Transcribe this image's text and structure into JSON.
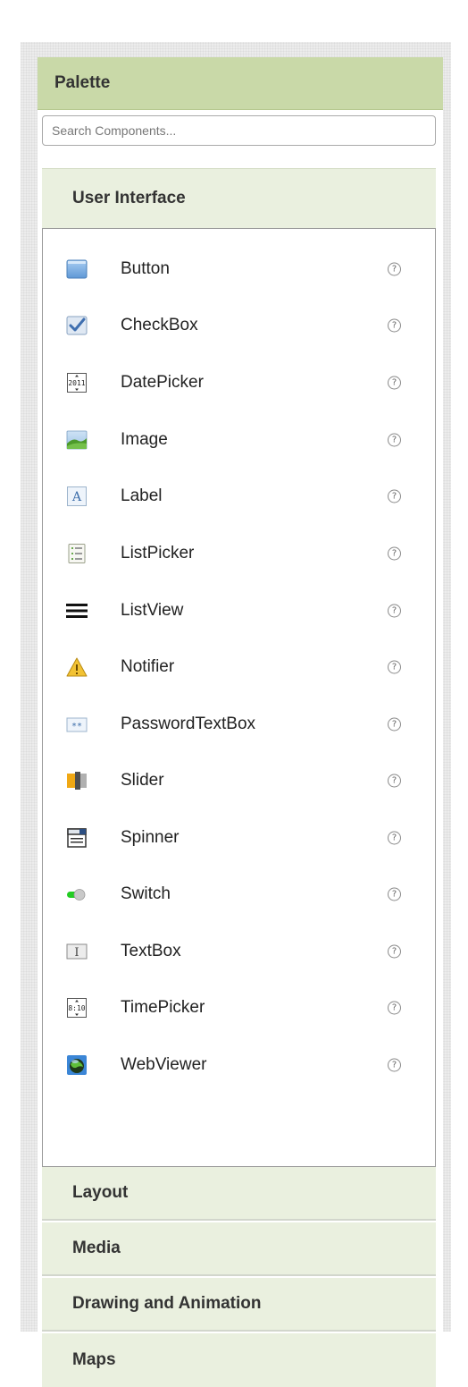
{
  "palette": {
    "title": "Palette",
    "search_placeholder": "Search Components..."
  },
  "user_interface": {
    "title": "User Interface",
    "items": [
      {
        "label": "Button",
        "icon": "button-icon"
      },
      {
        "label": "CheckBox",
        "icon": "checkbox-icon"
      },
      {
        "label": "DatePicker",
        "icon": "datepicker-icon"
      },
      {
        "label": "Image",
        "icon": "image-icon"
      },
      {
        "label": "Label",
        "icon": "label-icon"
      },
      {
        "label": "ListPicker",
        "icon": "listpicker-icon"
      },
      {
        "label": "ListView",
        "icon": "listview-icon"
      },
      {
        "label": "Notifier",
        "icon": "notifier-icon"
      },
      {
        "label": "PasswordTextBox",
        "icon": "passwordtextbox-icon"
      },
      {
        "label": "Slider",
        "icon": "slider-icon"
      },
      {
        "label": "Spinner",
        "icon": "spinner-icon"
      },
      {
        "label": "Switch",
        "icon": "switch-icon"
      },
      {
        "label": "TextBox",
        "icon": "textbox-icon"
      },
      {
        "label": "TimePicker",
        "icon": "timepicker-icon"
      },
      {
        "label": "WebViewer",
        "icon": "webviewer-icon"
      }
    ],
    "help_glyph": "?",
    "datepicker_icon_text": "2011",
    "timepicker_icon_text": "8:10",
    "label_icon_text": "A",
    "textbox_icon_text": "I",
    "password_icon_text": "**"
  },
  "categories": [
    {
      "label": "Layout"
    },
    {
      "label": "Media"
    },
    {
      "label": "Drawing and Animation"
    },
    {
      "label": "Maps"
    }
  ],
  "colors": {
    "header_bg": "#c9d9a8",
    "drawer_bg": "#eaf0df"
  }
}
